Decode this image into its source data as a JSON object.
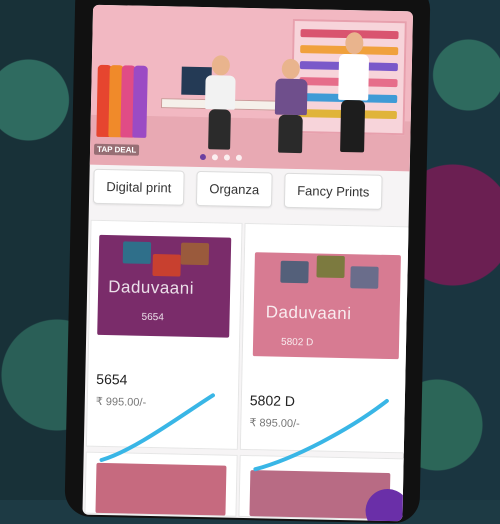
{
  "banner": {
    "logo": "TAP DEAL",
    "slides_total": 4,
    "slides_active": 0
  },
  "categories": [
    "Digital print",
    "Organza",
    "Fancy Prints"
  ],
  "products": [
    {
      "watermark": "Daduvaani",
      "image_code": "5654",
      "name": "5654",
      "price": "₹ 995.00/-"
    },
    {
      "watermark": "Daduvaani",
      "image_code": "5802 D",
      "name": "5802 D",
      "price": "₹ 895.00/-"
    }
  ],
  "colors": {
    "accent": "#6a2fa8",
    "scribble": "#39b6e6",
    "product1": "#7a2c6a",
    "product2": "#d77b92"
  }
}
